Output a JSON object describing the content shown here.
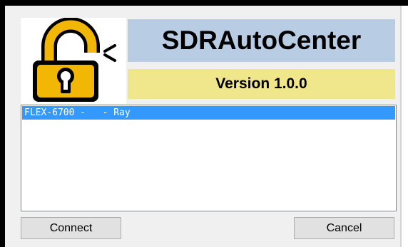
{
  "app": {
    "title": "SDRAutoCenter",
    "version_label": "Version 1.0.0",
    "logo_icon": "open-padlock-icon"
  },
  "radio_list": {
    "items": [
      {
        "label": "FLEX-6700 -   - Ray",
        "selected": true
      }
    ]
  },
  "buttons": {
    "connect_label": "Connect",
    "cancel_label": "Cancel"
  },
  "colors": {
    "title_background": "#b8cce4",
    "version_background": "#f0e68c",
    "selection": "#3399ff",
    "lock_gold": "#f2b705"
  }
}
